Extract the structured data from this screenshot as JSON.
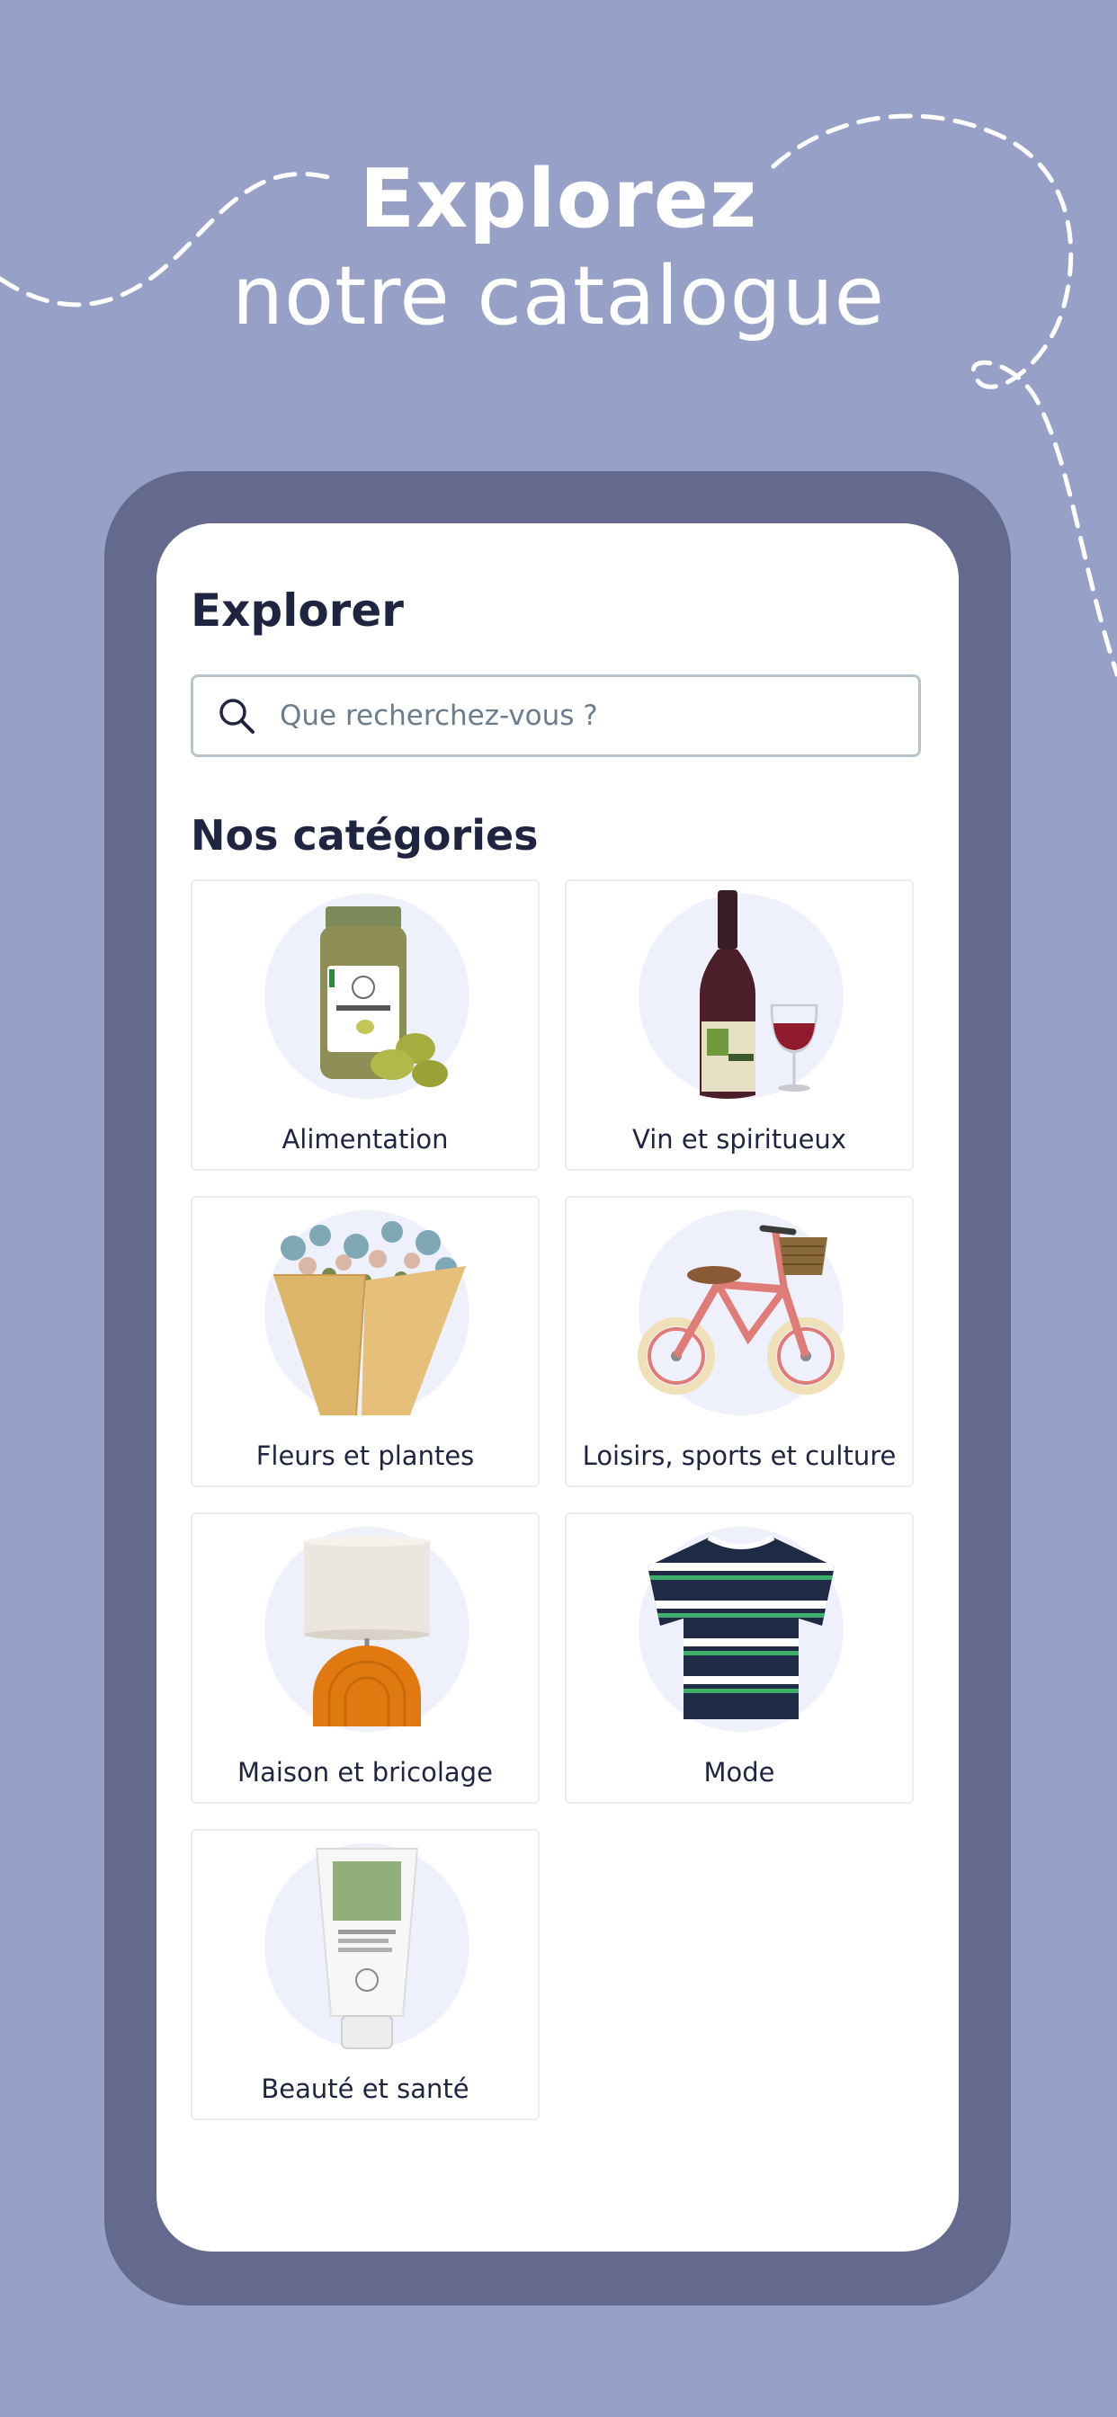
{
  "promo": {
    "headline_line1": "Explorez",
    "headline_line2": "notre catalogue"
  },
  "colors": {
    "background": "#97a1c8",
    "phone_frame": "#646a8e",
    "text": "#1f2540",
    "circle": "#eef0fb"
  },
  "screen": {
    "title": "Explorer",
    "search": {
      "placeholder": "Que recherchez-vous ?",
      "value": "",
      "icon": "search-icon"
    },
    "section_title": "Nos catégories",
    "categories": [
      {
        "label": "Alimentation",
        "icon": "olive-jar-image"
      },
      {
        "label": "Vin et spiritueux",
        "icon": "wine-bottle-image"
      },
      {
        "label": "Fleurs et plantes",
        "icon": "flower-bouquet-image"
      },
      {
        "label": "Loisirs, sports et culture",
        "icon": "balance-bike-image"
      },
      {
        "label": "Maison et bricolage",
        "icon": "table-lamp-image"
      },
      {
        "label": "Mode",
        "icon": "striped-tshirt-image"
      },
      {
        "label": "Beauté et santé",
        "icon": "cream-tube-image"
      }
    ]
  }
}
